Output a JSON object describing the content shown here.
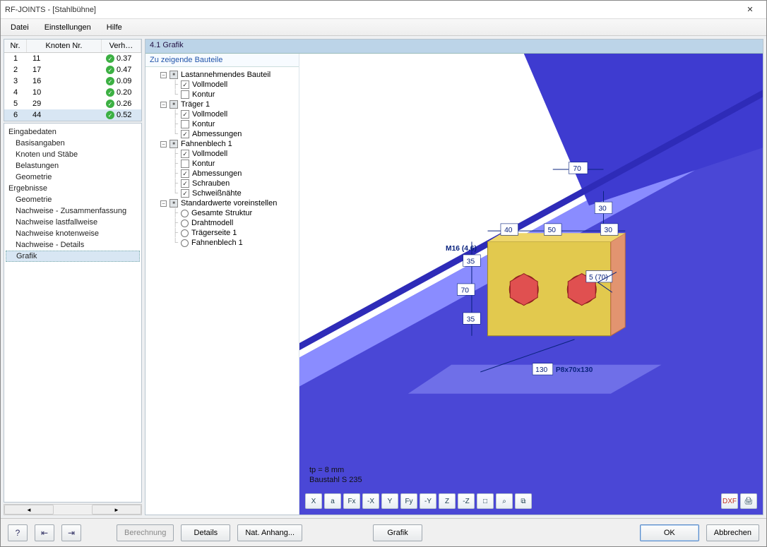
{
  "window": {
    "title": "RF-JOINTS - [Stahlbühne]"
  },
  "menus": [
    "Datei",
    "Einstellungen",
    "Hilfe"
  ],
  "results_table": {
    "columns": [
      "Nr.",
      "Knoten Nr.",
      "Verh…"
    ],
    "rows": [
      {
        "nr": "1",
        "knoten": "11",
        "verh": "0.37"
      },
      {
        "nr": "2",
        "knoten": "17",
        "verh": "0.47"
      },
      {
        "nr": "3",
        "knoten": "16",
        "verh": "0.09"
      },
      {
        "nr": "4",
        "knoten": "10",
        "verh": "0.20"
      },
      {
        "nr": "5",
        "knoten": "29",
        "verh": "0.26"
      },
      {
        "nr": "6",
        "knoten": "44",
        "verh": "0.52"
      }
    ],
    "selected": 5
  },
  "nav": {
    "groups": [
      {
        "label": "Eingabedaten",
        "items": [
          "Basisangaben",
          "Knoten und Stäbe",
          "Belastungen",
          "Geometrie"
        ]
      },
      {
        "label": "Ergebnisse",
        "items": [
          "Geometrie",
          "Nachweise - Zusammenfassung",
          "Nachweise lastfallweise",
          "Nachweise knotenweise",
          "Nachweise - Details",
          "Grafik"
        ]
      }
    ],
    "selected": "Grafik"
  },
  "panel_title": "4.1 Grafik",
  "tree_header": "Zu zeigende Bauteile",
  "tree": [
    {
      "type": "group",
      "label": "Lastannehmendes Bauteil",
      "neutral": true,
      "children": [
        {
          "type": "check",
          "label": "Vollmodell",
          "checked": true
        },
        {
          "type": "check",
          "label": "Kontur",
          "checked": false
        }
      ]
    },
    {
      "type": "group",
      "label": "Träger 1",
      "neutral": true,
      "children": [
        {
          "type": "check",
          "label": "Vollmodell",
          "checked": true
        },
        {
          "type": "check",
          "label": "Kontur",
          "checked": false
        },
        {
          "type": "check",
          "label": "Abmessungen",
          "checked": true
        }
      ]
    },
    {
      "type": "group",
      "label": "Fahnenblech 1",
      "neutral": true,
      "children": [
        {
          "type": "check",
          "label": "Vollmodell",
          "checked": true
        },
        {
          "type": "check",
          "label": "Kontur",
          "checked": false
        },
        {
          "type": "check",
          "label": "Abmessungen",
          "checked": true
        },
        {
          "type": "check",
          "label": "Schrauben",
          "checked": true
        },
        {
          "type": "check",
          "label": "Schweißnähte",
          "checked": true
        }
      ]
    },
    {
      "type": "group",
      "label": "Standardwerte voreinstellen",
      "neutral": true,
      "children": [
        {
          "type": "radio",
          "label": "Gesamte Struktur"
        },
        {
          "type": "radio",
          "label": "Drahtmodell"
        },
        {
          "type": "radio",
          "label": "Trägerseite 1"
        },
        {
          "type": "radio",
          "label": "Fahnenblech 1"
        }
      ]
    }
  ],
  "graphic": {
    "info_line1": "tp = 8 mm",
    "info_line2": "Baustahl S 235",
    "dims": {
      "top70": "70",
      "v30": "30",
      "h40": "40",
      "h50": "50",
      "hright30": "30",
      "v35a": "35",
      "v70": "70",
      "v35b": "35",
      "b130": "130",
      "bolt_text": "M16 (4.6)",
      "hole_text": "5 (70)",
      "plate_text": "P8x70x130"
    }
  },
  "view_toolbar": [
    "X",
    "a",
    "Fx",
    "-X",
    "Y",
    "Fy",
    "-Y",
    "Z",
    "-Z",
    "□",
    "⌕",
    "⧉"
  ],
  "bottom": {
    "berechnung": "Berechnung",
    "details": "Details",
    "natanhang": "Nat. Anhang...",
    "grafik": "Grafik",
    "ok": "OK",
    "abbrechen": "Abbrechen"
  }
}
